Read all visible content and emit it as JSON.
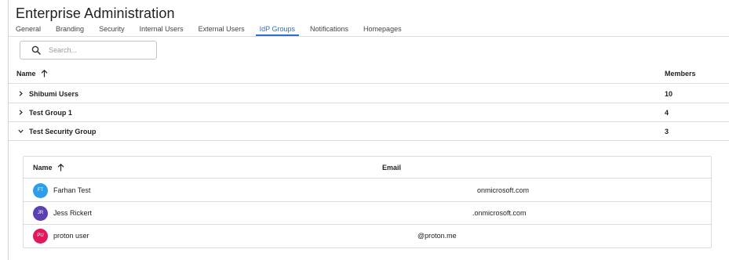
{
  "page": {
    "title": "Enterprise Administration"
  },
  "tabs": [
    {
      "label": "General"
    },
    {
      "label": "Branding"
    },
    {
      "label": "Security"
    },
    {
      "label": "Internal Users"
    },
    {
      "label": "External Users"
    },
    {
      "label": "IdP Groups",
      "active": true
    },
    {
      "label": "Notifications"
    },
    {
      "label": "Homepages"
    }
  ],
  "search": {
    "placeholder": "Search...",
    "icon": "search-icon"
  },
  "groups_table": {
    "headers": {
      "name": "Name",
      "members": "Members"
    },
    "sort": "ascending",
    "rows": [
      {
        "name": "Shibumi Users",
        "members": "10",
        "expanded": false
      },
      {
        "name": "Test Group 1",
        "members": "4",
        "expanded": false
      },
      {
        "name": "Test Security Group",
        "members": "3",
        "expanded": true
      }
    ]
  },
  "members_table": {
    "headers": {
      "name": "Name",
      "email": "Email"
    },
    "sort": "ascending",
    "rows": [
      {
        "initials": "FT",
        "name": "Farhan Test",
        "email": "onmicrosoft.com",
        "color": "#2f9de8"
      },
      {
        "initials": "JR",
        "name": "Jess Rickert",
        "email": ".onmicrosoft.com",
        "color": "#5b3fb3"
      },
      {
        "initials": "PU",
        "name": "proton user",
        "email": "@proton.me",
        "color": "#e0195f"
      }
    ]
  },
  "colors": {
    "accent": "#2a6fd1",
    "border": "#dcdcdc"
  }
}
